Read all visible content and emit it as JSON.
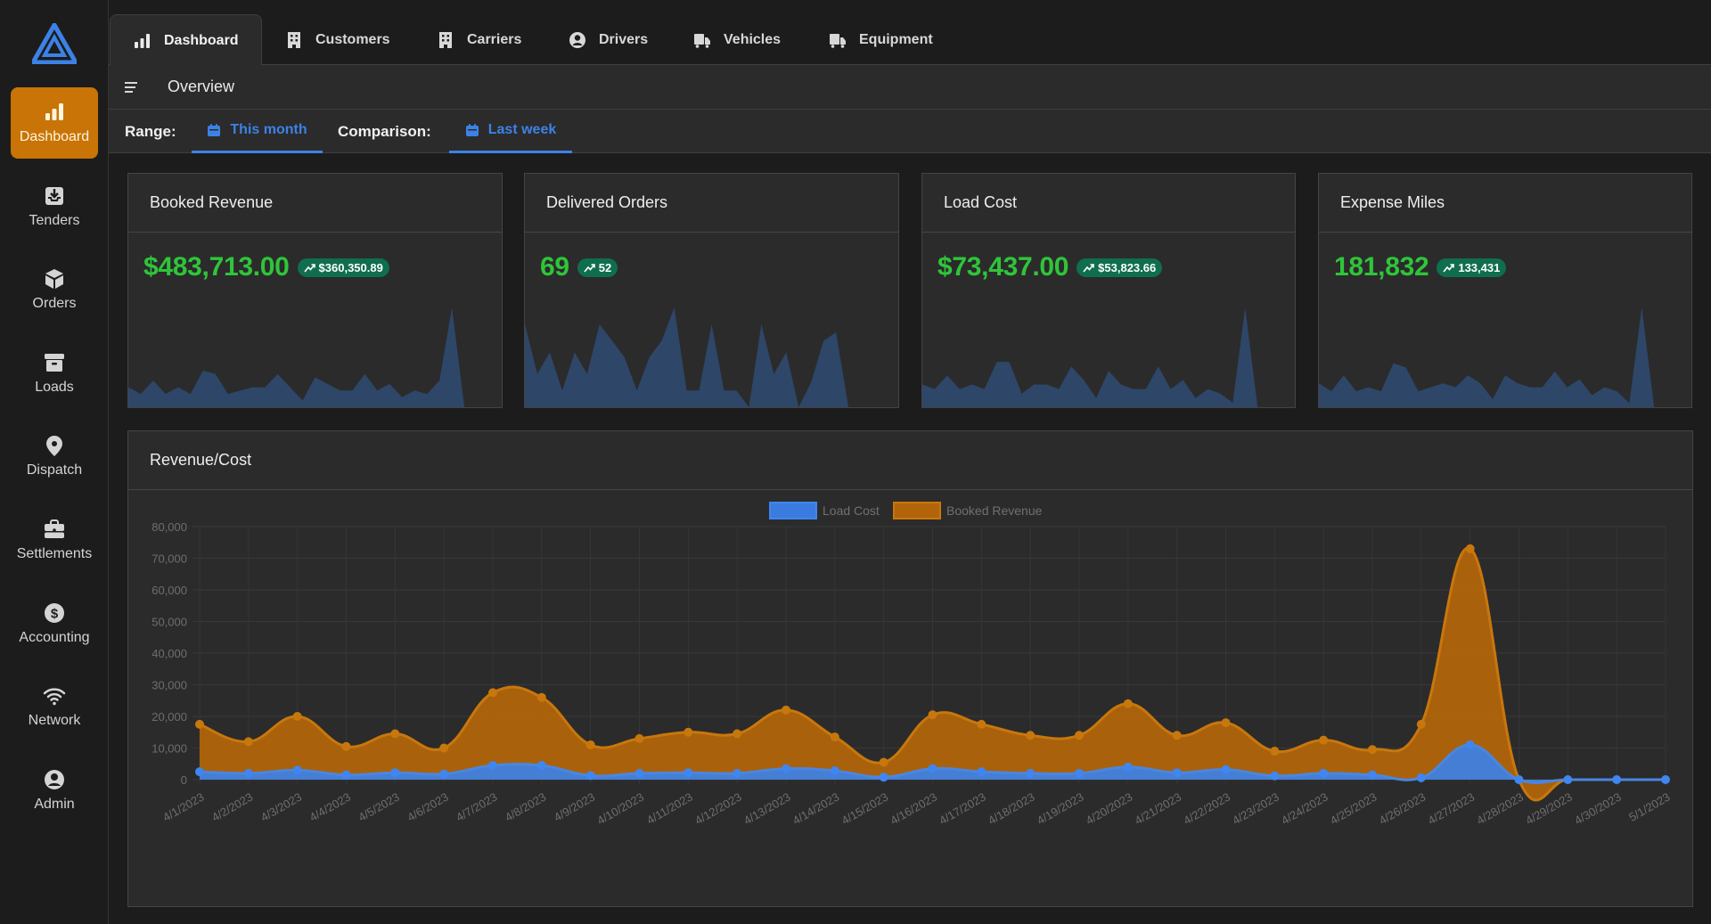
{
  "sidebar": {
    "items": [
      {
        "label": "Dashboard",
        "icon": "bar-chart-icon",
        "active": true
      },
      {
        "label": "Tenders",
        "icon": "inbox-download-icon"
      },
      {
        "label": "Orders",
        "icon": "cube-icon"
      },
      {
        "label": "Loads",
        "icon": "archive-box-icon"
      },
      {
        "label": "Dispatch",
        "icon": "map-pin-icon"
      },
      {
        "label": "Settlements",
        "icon": "briefcase-icon"
      },
      {
        "label": "Accounting",
        "icon": "dollar-circle-icon"
      },
      {
        "label": "Network",
        "icon": "wifi-icon"
      },
      {
        "label": "Admin",
        "icon": "user-circle-icon"
      }
    ]
  },
  "tabs": [
    {
      "label": "Dashboard",
      "icon": "bar-chart-icon",
      "active": true
    },
    {
      "label": "Customers",
      "icon": "building-icon"
    },
    {
      "label": "Carriers",
      "icon": "building-icon"
    },
    {
      "label": "Drivers",
      "icon": "user-circle-icon"
    },
    {
      "label": "Vehicles",
      "icon": "truck-icon"
    },
    {
      "label": "Equipment",
      "icon": "truck-icon"
    }
  ],
  "overview": {
    "title": "Overview"
  },
  "range": {
    "range_label": "Range:",
    "range_value": "This month",
    "comparison_label": "Comparison:",
    "comparison_value": "Last week"
  },
  "kpis": [
    {
      "title": "Booked Revenue",
      "value": "$483,713.00",
      "comparison": "$360,350.89",
      "spark": [
        6,
        4,
        8,
        4,
        6,
        4,
        11,
        10,
        4,
        5,
        6,
        6,
        10,
        6,
        2,
        9,
        7,
        5,
        5,
        10,
        5,
        7,
        3,
        5,
        4,
        8,
        30,
        0,
        0,
        0,
        0
      ]
    },
    {
      "title": "Delivered Orders",
      "value": "69",
      "comparison": "52",
      "spark": [
        5,
        2,
        3.3,
        1,
        3.3,
        2,
        5,
        4,
        3,
        1,
        3,
        4,
        6,
        1,
        1,
        5,
        1,
        1,
        0,
        5,
        2,
        3.3,
        0,
        1.5,
        4,
        4.5,
        0,
        0,
        0,
        0,
        0
      ]
    },
    {
      "title": "Load Cost",
      "value": "$73,437.00",
      "comparison": "$53,823.66",
      "spark": [
        5,
        4,
        7,
        4,
        5,
        4,
        10,
        10,
        3,
        5,
        5,
        4,
        9,
        6,
        2,
        8,
        5,
        4,
        4,
        9,
        4,
        6,
        2,
        4,
        3,
        1,
        22,
        0,
        0,
        0,
        0
      ]
    },
    {
      "title": "Expense Miles",
      "value": "181,832",
      "comparison": "133,431",
      "spark": [
        6,
        4,
        8,
        4,
        5,
        4,
        11,
        10,
        4,
        5,
        6,
        5,
        8,
        6,
        2,
        8,
        6,
        5,
        5,
        9,
        5,
        7,
        3,
        5,
        4,
        1,
        25,
        0,
        0,
        0,
        0
      ]
    }
  ],
  "colors": {
    "accent": "#c87407",
    "link_blue": "#3c82e6",
    "kpi_green": "#2fc53a",
    "badge_green": "#0f6e4e",
    "spark_fill": "#2e4668",
    "revenue": "#b1640a",
    "cost": "#3f7fe0"
  },
  "chart_data": {
    "type": "area",
    "title": "Revenue/Cost",
    "xlabel": "",
    "ylabel": "",
    "ylim": [
      0,
      80000
    ],
    "yticks": [
      0,
      10000,
      20000,
      30000,
      40000,
      50000,
      60000,
      70000,
      80000
    ],
    "ytick_labels": [
      "0",
      "10,000",
      "20,000",
      "30,000",
      "40,000",
      "50,000",
      "60,000",
      "70,000",
      "80,000"
    ],
    "grid": true,
    "legend_position": "top-center",
    "categories": [
      "4/1/2023",
      "4/2/2023",
      "4/3/2023",
      "4/4/2023",
      "4/5/2023",
      "4/6/2023",
      "4/7/2023",
      "4/8/2023",
      "4/9/2023",
      "4/10/2023",
      "4/11/2023",
      "4/12/2023",
      "4/13/2023",
      "4/14/2023",
      "4/15/2023",
      "4/16/2023",
      "4/17/2023",
      "4/18/2023",
      "4/19/2023",
      "4/20/2023",
      "4/21/2023",
      "4/22/2023",
      "4/23/2023",
      "4/24/2023",
      "4/25/2023",
      "4/26/2023",
      "4/27/2023",
      "4/28/2023",
      "4/29/2023",
      "4/30/2023",
      "5/1/2023"
    ],
    "series": [
      {
        "name": "Load Cost",
        "color": "#3f7fe0",
        "values": [
          2500,
          2000,
          3000,
          1500,
          2200,
          1800,
          4500,
          4500,
          1300,
          2000,
          2200,
          2000,
          3500,
          2800,
          800,
          3500,
          2500,
          2000,
          2000,
          4000,
          2200,
          3200,
          1200,
          2000,
          1500,
          600,
          11000,
          0,
          0,
          0,
          0
        ]
      },
      {
        "name": "Booked Revenue",
        "color": "#b1640a",
        "values": [
          17500,
          12000,
          20000,
          10500,
          14500,
          10000,
          27500,
          26000,
          11000,
          13000,
          15000,
          14500,
          22000,
          13500,
          5500,
          20500,
          17500,
          14000,
          14000,
          24000,
          14000,
          18000,
          9000,
          12500,
          9500,
          17500,
          73000,
          0,
          0,
          0,
          0
        ]
      }
    ]
  }
}
